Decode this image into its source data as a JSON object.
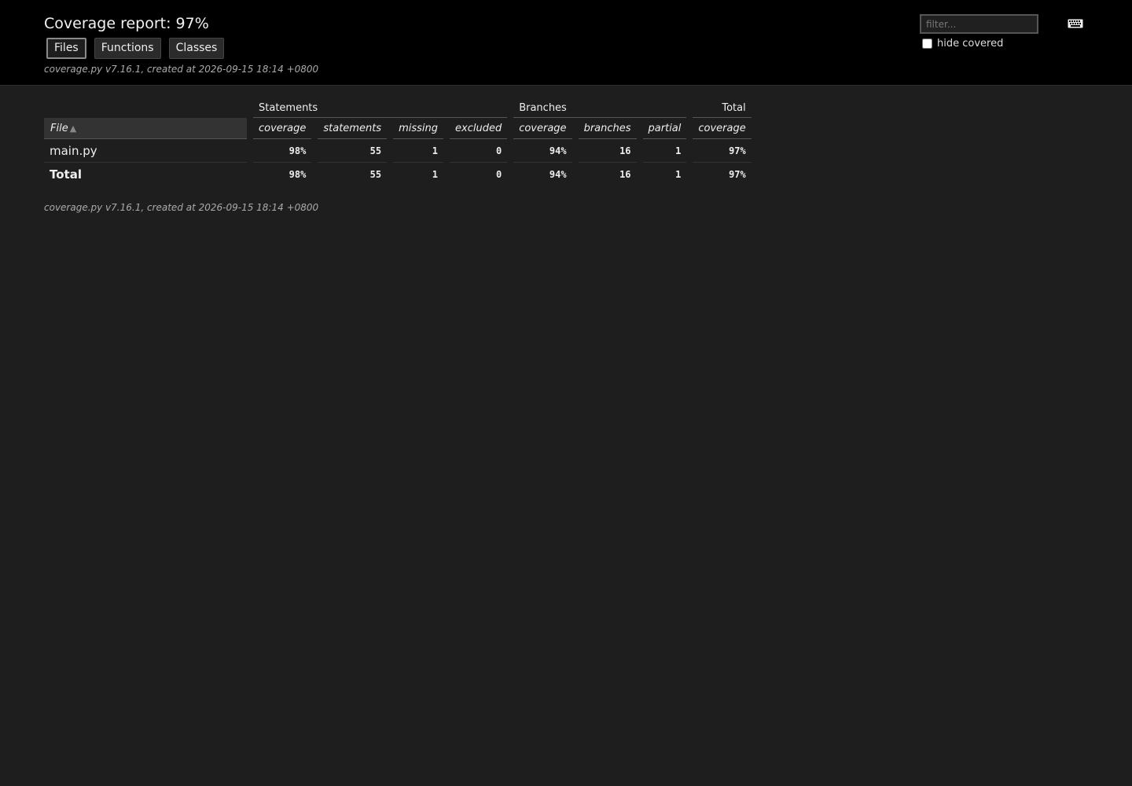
{
  "header": {
    "title": "Coverage report: 97%",
    "tabs": [
      "Files",
      "Functions",
      "Classes"
    ],
    "created": "coverage.py v7.16.1, created at 2026-09-15 18:14 +0800",
    "filter_placeholder": "filter...",
    "hide_covered_label": "hide covered",
    "keyboard_icon": "keyboard-icon"
  },
  "table": {
    "groups": {
      "statements": "Statements",
      "branches": "Branches",
      "total": "Total"
    },
    "columns": {
      "file": "File",
      "stmt_coverage": "coverage",
      "statements": "statements",
      "missing": "missing",
      "excluded": "excluded",
      "br_coverage": "coverage",
      "branches": "branches",
      "partial": "partial",
      "total_coverage": "coverage"
    },
    "rows": [
      {
        "name": "main.py",
        "stmt_coverage": "98%",
        "statements": "55",
        "missing": "1",
        "excluded": "0",
        "br_coverage": "94%",
        "branches": "16",
        "partial": "1",
        "total_coverage": "97%"
      }
    ],
    "total": {
      "name": "Total",
      "stmt_coverage": "98%",
      "statements": "55",
      "missing": "1",
      "excluded": "0",
      "br_coverage": "94%",
      "branches": "16",
      "partial": "1",
      "total_coverage": "97%"
    }
  },
  "footer": {
    "created": "coverage.py v7.16.1, created at 2026-09-15 18:14 +0800"
  }
}
